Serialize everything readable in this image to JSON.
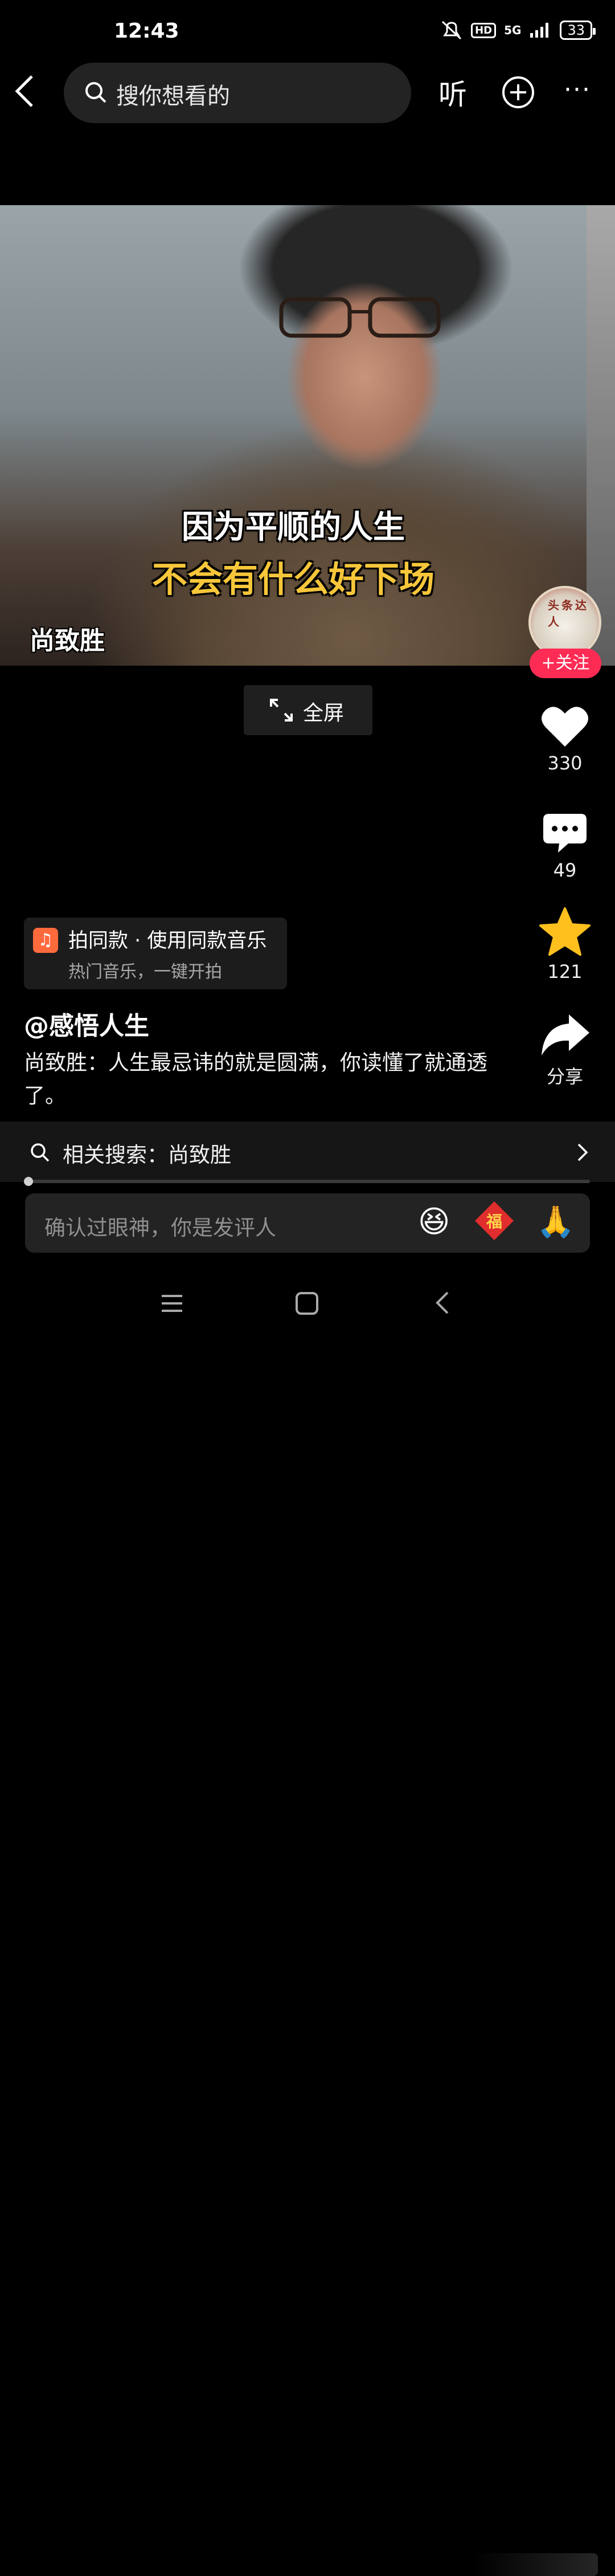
{
  "status_bar": {
    "time": "12:43",
    "network": "5G",
    "hd": "HD",
    "battery": "33"
  },
  "header": {
    "search_placeholder": "搜你想看的",
    "listen_label": "听",
    "more_label": "···"
  },
  "video": {
    "subtitle_line1": "因为平顺的人生",
    "subtitle_line2": "不会有什么好下场",
    "speaker_name": "尚致胜",
    "fullscreen_label": "全屏"
  },
  "author": {
    "avatar_stamp": "头条达人",
    "follow_label": "+关注",
    "handle": "@感悟人生"
  },
  "actions": {
    "likes": "330",
    "comments": "49",
    "favorites": "121",
    "share_label": "分享"
  },
  "music": {
    "title": "拍同款 · 使用同款音乐",
    "subtitle": "热门音乐，一键开拍",
    "icon": "music-note-icon"
  },
  "caption": "尚致胜：人生最忌讳的就是圆满，你读懂了就通透了。",
  "related_search": {
    "label": "相关搜索：尚致胜"
  },
  "playback": {
    "progress": 0
  },
  "comment_bar": {
    "placeholder": "确认过眼神，你是发评人",
    "fu_label": "福"
  },
  "colors": {
    "follow": "#fe2c55",
    "favorite": "#ffc01e",
    "subtitle_highlight": "#f7c63a"
  }
}
